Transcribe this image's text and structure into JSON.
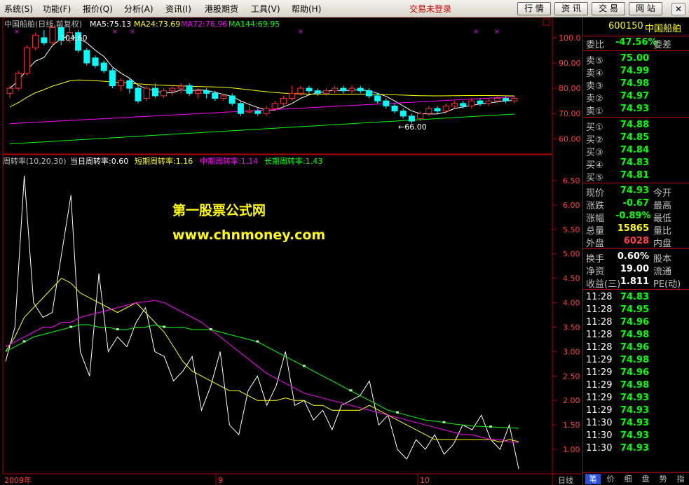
{
  "menu": {
    "items": [
      "系统(S)",
      "功能(F)",
      "报价(Q)",
      "分析(A)",
      "资讯(I)",
      "港股期货",
      "工具(V)",
      "帮助(H)"
    ],
    "login_status": "交易未登录",
    "top_buttons": [
      "行 情",
      "资 讯",
      "交 易",
      "网 站"
    ]
  },
  "main_chart": {
    "title": "中国船舶(日线,前复权)",
    "ma5_label": "MA5:75.13",
    "ma24_label": "MA24:73.69",
    "ma72_label": "MA72:76.96",
    "ma144_label": "MA144:69.95",
    "high_mark": "104.60",
    "low_mark": "←66.00",
    "y_ticks": [
      "100.0",
      "90.00",
      "80.00",
      "70.00",
      "60.00"
    ],
    "colors": {
      "ma5": "#ffffff",
      "ma24": "#ffff00",
      "ma72": "#ff00ff",
      "ma144": "#00ff00",
      "up": "#ff3030",
      "down": "#00ffff"
    }
  },
  "indicator": {
    "title": "周转率(10,20,30)",
    "daily_label": "当日周转率:0.60",
    "short_label": "短期周转率:1.16",
    "mid_label": "中期周转率:1.14",
    "long_label": "长期周转率:1.43",
    "y_ticks": [
      "6.50",
      "6.00",
      "5.50",
      "5.00",
      "4.50",
      "4.00",
      "3.50",
      "3.00",
      "2.50",
      "2.00",
      "1.50",
      "1.00"
    ],
    "watermark_title": "第一股票公式网",
    "watermark_url": "www.chnmoney.com"
  },
  "chart_data": {
    "type": "line",
    "title": "周转率(10,20,30)",
    "ylim": [
      0.5,
      6.8
    ],
    "series": [
      {
        "name": "当日周转率",
        "color": "#ffffff",
        "values": [
          2.8,
          3.5,
          6.6,
          4.0,
          3.7,
          3.8,
          5.0,
          6.2,
          3.0,
          2.5,
          4.6,
          3.0,
          3.3,
          3.1,
          3.6,
          3.9,
          3.0,
          2.9,
          2.4,
          2.6,
          2.9,
          1.8,
          2.3,
          3.0,
          1.5,
          1.3,
          2.2,
          2.5,
          1.9,
          2.3,
          3.0,
          1.9,
          2.0,
          1.6,
          1.8,
          1.4,
          1.9,
          2.0,
          2.1,
          2.4,
          1.5,
          1.7,
          1.0,
          0.8,
          1.2,
          1.0,
          1.3,
          0.9,
          1.1,
          1.5,
          1.4,
          1.7,
          1.2,
          1.0,
          1.5,
          0.6
        ]
      },
      {
        "name": "短期周转率",
        "color": "#ffff00",
        "values": [
          3.0,
          3.3,
          3.7,
          3.9,
          4.1,
          4.3,
          4.5,
          4.4,
          4.2,
          4.1,
          4.0,
          3.9,
          3.8,
          3.9,
          4.0,
          3.8,
          3.6,
          3.4,
          3.1,
          2.8,
          2.6,
          2.5,
          2.4,
          2.3,
          2.2,
          2.2,
          2.1,
          2.0,
          2.0,
          2.0,
          2.05,
          2.0,
          2.0,
          1.9,
          1.9,
          1.8,
          1.8,
          1.8,
          1.8,
          1.9,
          1.8,
          1.7,
          1.6,
          1.5,
          1.4,
          1.3,
          1.2,
          1.2,
          1.2,
          1.2,
          1.2,
          1.2,
          1.2,
          1.15,
          1.2,
          1.16
        ]
      },
      {
        "name": "中期周转率",
        "color": "#ff00ff",
        "values": [
          3.1,
          3.2,
          3.3,
          3.4,
          3.5,
          3.5,
          3.6,
          3.6,
          3.7,
          3.75,
          3.8,
          3.85,
          3.9,
          3.95,
          4.0,
          4.02,
          4.05,
          4.0,
          3.9,
          3.8,
          3.7,
          3.6,
          3.45,
          3.3,
          3.15,
          3.0,
          2.85,
          2.7,
          2.55,
          2.45,
          2.35,
          2.25,
          2.15,
          2.1,
          2.05,
          2.0,
          1.95,
          1.9,
          1.85,
          1.8,
          1.75,
          1.7,
          1.65,
          1.6,
          1.55,
          1.5,
          1.45,
          1.4,
          1.35,
          1.3,
          1.3,
          1.25,
          1.2,
          1.2,
          1.15,
          1.14
        ]
      },
      {
        "name": "长期周转率",
        "color": "#00ff00",
        "values": [
          3.0,
          3.1,
          3.2,
          3.3,
          3.35,
          3.4,
          3.45,
          3.5,
          3.55,
          3.55,
          3.5,
          3.5,
          3.45,
          3.45,
          3.5,
          3.5,
          3.55,
          3.5,
          3.5,
          3.5,
          3.45,
          3.45,
          3.45,
          3.4,
          3.35,
          3.3,
          3.25,
          3.2,
          3.1,
          3.0,
          2.9,
          2.8,
          2.7,
          2.6,
          2.5,
          2.4,
          2.3,
          2.2,
          2.1,
          2.0,
          1.9,
          1.8,
          1.75,
          1.7,
          1.65,
          1.6,
          1.58,
          1.55,
          1.52,
          1.5,
          1.48,
          1.47,
          1.46,
          1.45,
          1.44,
          1.43
        ]
      }
    ]
  },
  "candles": [
    [
      78,
      80,
      76,
      81
    ],
    [
      80,
      86,
      79,
      87
    ],
    [
      86,
      96,
      85,
      97
    ],
    [
      96,
      101,
      95,
      102
    ],
    [
      100,
      98,
      97,
      103
    ],
    [
      98,
      104,
      97,
      105
    ],
    [
      104,
      99,
      97,
      105
    ],
    [
      99,
      102,
      98,
      104.6
    ],
    [
      102,
      95,
      94,
      103
    ],
    [
      95,
      90,
      89,
      96
    ],
    [
      92,
      89,
      88,
      93
    ],
    [
      90,
      87,
      86,
      91
    ],
    [
      87,
      81,
      80,
      88
    ],
    [
      81,
      83,
      79,
      84
    ],
    [
      83,
      80,
      78,
      84
    ],
    [
      80,
      75,
      74,
      81
    ],
    [
      76,
      80,
      75,
      81
    ],
    [
      80,
      77,
      76,
      82
    ],
    [
      77,
      79,
      76,
      80
    ],
    [
      79,
      80,
      77,
      81
    ],
    [
      80,
      80.8,
      78,
      82
    ],
    [
      81,
      78,
      77,
      82
    ],
    [
      78,
      79,
      76,
      80
    ],
    [
      79,
      78,
      76,
      80
    ],
    [
      78,
      76,
      75,
      79
    ],
    [
      76,
      77,
      75,
      78
    ],
    [
      77,
      74,
      73,
      78
    ],
    [
      74,
      70,
      69,
      75
    ],
    [
      71,
      71,
      70,
      73
    ],
    [
      71,
      70,
      69,
      72
    ],
    [
      70,
      72,
      69,
      73
    ],
    [
      72,
      74,
      71,
      75
    ],
    [
      74,
      76,
      73,
      77
    ],
    [
      76,
      78,
      75,
      81
    ],
    [
      78,
      80,
      77,
      81
    ],
    [
      80,
      79,
      78,
      81
    ],
    [
      79,
      78,
      77,
      80
    ],
    [
      78,
      79,
      77,
      80
    ],
    [
      79,
      80,
      78,
      81
    ],
    [
      80,
      79,
      78,
      81
    ],
    [
      79,
      80,
      78,
      81
    ],
    [
      80,
      79,
      78,
      81
    ],
    [
      79,
      77,
      76,
      80
    ],
    [
      77,
      75,
      74,
      78
    ],
    [
      75,
      73,
      72,
      76
    ],
    [
      73,
      71,
      70,
      74
    ],
    [
      71,
      69,
      68,
      72
    ],
    [
      69,
      67,
      66,
      70
    ],
    [
      68,
      70,
      67,
      71
    ],
    [
      70,
      72,
      69,
      73
    ],
    [
      72,
      71,
      70,
      73
    ],
    [
      71,
      73,
      70,
      74
    ],
    [
      73,
      74,
      72,
      75
    ],
    [
      74,
      73,
      72,
      75
    ],
    [
      73,
      75,
      72,
      76
    ],
    [
      75,
      74,
      73,
      76
    ],
    [
      74,
      75,
      73,
      76
    ],
    [
      75,
      76,
      74,
      77
    ],
    [
      76,
      75,
      74,
      77
    ],
    [
      75,
      76,
      74,
      77
    ]
  ],
  "x_labels": [
    "2009年",
    "9",
    "10"
  ],
  "period_label": "日线",
  "quote": {
    "code": "600150",
    "name": "中国船舶",
    "weibi_label": "委比",
    "weibi_value": "-47.56%",
    "weicha_label": "委差",
    "sells": [
      {
        "label": "卖⑤",
        "price": "75.00"
      },
      {
        "label": "卖④",
        "price": "74.99"
      },
      {
        "label": "卖③",
        "price": "74.98"
      },
      {
        "label": "卖②",
        "price": "74.97"
      },
      {
        "label": "卖①",
        "price": "74.93"
      }
    ],
    "buys": [
      {
        "label": "买①",
        "price": "74.88"
      },
      {
        "label": "买②",
        "price": "74.85"
      },
      {
        "label": "买③",
        "price": "74.84"
      },
      {
        "label": "买④",
        "price": "74.83"
      },
      {
        "label": "买⑤",
        "price": "74.81"
      }
    ],
    "stats": [
      {
        "label": "现价",
        "value": "74.93",
        "right": "今开",
        "color": "#00ff00"
      },
      {
        "label": "涨跌",
        "value": "-0.67",
        "right": "最高",
        "color": "#00ff00"
      },
      {
        "label": "涨幅",
        "value": "-0.89%",
        "right": "最低",
        "color": "#00ff00"
      },
      {
        "label": "总量",
        "value": "15865",
        "right": "量比",
        "color": "#ffff00"
      },
      {
        "label": "外盘",
        "value": "6028",
        "right": "内盘",
        "color": "#ff4040"
      }
    ],
    "stats2": [
      {
        "label": "换手",
        "value": "0.60%",
        "right": "股本"
      },
      {
        "label": "净资",
        "value": "19.00",
        "right": "流通"
      },
      {
        "label": "收益(三)",
        "value": "1.811",
        "right": "PE(动)"
      }
    ],
    "ticks": [
      {
        "time": "11:28",
        "price": "74.83"
      },
      {
        "time": "11:28",
        "price": "74.95"
      },
      {
        "time": "11:28",
        "price": "74.96"
      },
      {
        "time": "11:28",
        "price": "74.98"
      },
      {
        "time": "11:28",
        "price": "74.96"
      },
      {
        "time": "11:29",
        "price": "74.98"
      },
      {
        "time": "11:29",
        "price": "74.96"
      },
      {
        "time": "11:29",
        "price": "74.98"
      },
      {
        "time": "11:29",
        "price": "74.93"
      },
      {
        "time": "11:29",
        "price": "74.93"
      },
      {
        "time": "11:30",
        "price": "74.93"
      },
      {
        "time": "11:30",
        "price": "74.93"
      },
      {
        "time": "11:30",
        "price": "74.93"
      }
    ],
    "tabs": [
      "笔",
      "价",
      "细",
      "盘",
      "势",
      "指"
    ]
  }
}
